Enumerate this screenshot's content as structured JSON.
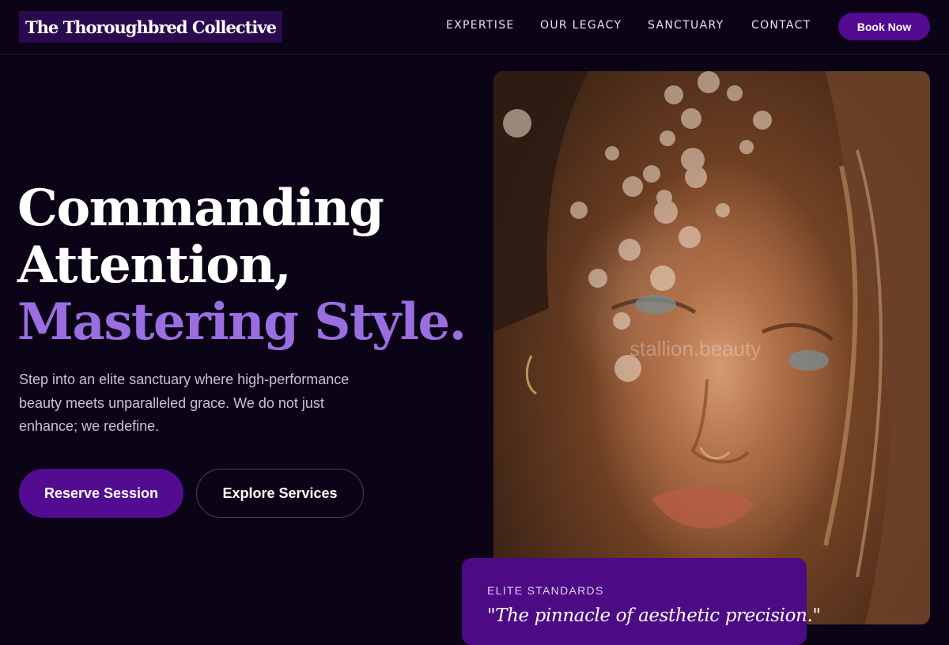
{
  "header": {
    "logo": "The Thoroughbred Collective",
    "nav": [
      "EXPERTISE",
      "OUR LEGACY",
      "SANCTUARY",
      "CONTACT"
    ],
    "cta_label": "Book Now"
  },
  "hero": {
    "title_line1": "Commanding",
    "title_line2": "Attention,",
    "title_line3": "Mastering Style.",
    "subtitle": "Step into an elite sanctuary where high-performance beauty meets unparalleled grace. We do not just enhance; we redefine.",
    "primary_button": "Reserve Session",
    "secondary_button": "Explore Services"
  },
  "image": {
    "watermark": "stallion.beauty"
  },
  "quote_card": {
    "eyebrow": "ELITE STANDARDS",
    "quote": "\"The pinnacle of aesthetic precision.\""
  },
  "colors": {
    "background": "#0b0416",
    "accent_purple": "#520b91",
    "title_accent": "#9a6ee0",
    "card": "#4c0a84"
  }
}
